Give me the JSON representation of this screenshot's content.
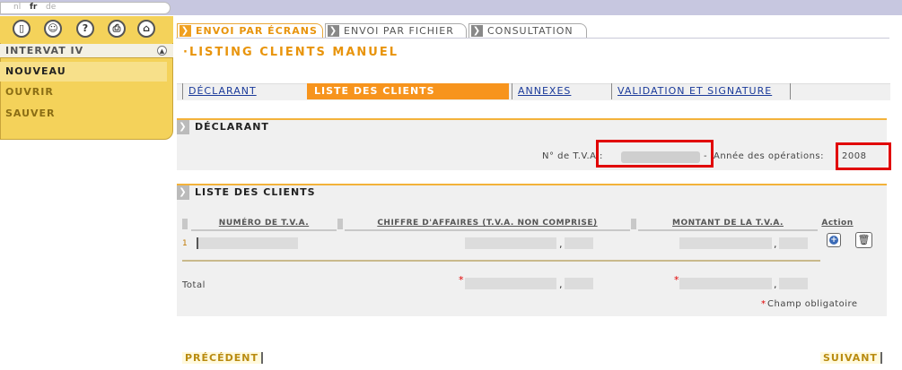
{
  "languages": [
    {
      "code": "nl",
      "active": false
    },
    {
      "code": "fr",
      "active": true
    },
    {
      "code": "de",
      "active": false
    }
  ],
  "toolbar_icons": [
    "door-icon",
    "user-icon",
    "help-icon",
    "print-icon",
    "home-icon"
  ],
  "toolbar_glyphs": [
    "▯",
    "☺",
    "?",
    "⎙",
    "⌂"
  ],
  "sidebar": {
    "title": "INTERVAT IV",
    "items": [
      {
        "label": "NOUVEAU",
        "active": true
      },
      {
        "label": "OUVRIR",
        "active": false
      },
      {
        "label": "SAUVER",
        "active": false
      }
    ]
  },
  "top_tabs": [
    {
      "label": "ENVOI PAR ÉCRANS",
      "active": true
    },
    {
      "label": "ENVOI PAR FICHIER",
      "active": false
    },
    {
      "label": "CONSULTATION",
      "active": false
    }
  ],
  "page_title": "·LISTING CLIENTS MANUEL",
  "sub_tabs": [
    {
      "label": "DÉCLARANT",
      "active": false
    },
    {
      "label": "LISTE DES CLIENTS",
      "active": true
    },
    {
      "label": "ANNEXES",
      "active": false
    },
    {
      "label": "VALIDATION ET SIGNATURE",
      "active": false
    }
  ],
  "declarant": {
    "header": "DÉCLARANT",
    "vat_label": "N° de T.V.A.:",
    "year_separator": "-",
    "year_label": "Année des opérations:",
    "year_value": "2008"
  },
  "clients": {
    "header": "LISTE DES CLIENTS",
    "columns": [
      "NUMÉRO DE T.V.A.",
      "CHIFFRE D'AFFAIRES (T.V.A. NON COMPRISE)",
      "MONTANT DE LA T.V.A."
    ],
    "action_label": "Action",
    "row_number": "1",
    "decimal_sep": ",",
    "total_label": "Total",
    "required_mark": "*",
    "required_note": "Champ obligatoire"
  },
  "navigation": {
    "previous": "PRÉCÉDENT",
    "next": "SUIVANT"
  },
  "colors": {
    "accent_orange": "#f7941d",
    "panel_yellow": "#f4d25a",
    "highlight_red": "#e10000",
    "link_blue": "#1a3a9a"
  }
}
